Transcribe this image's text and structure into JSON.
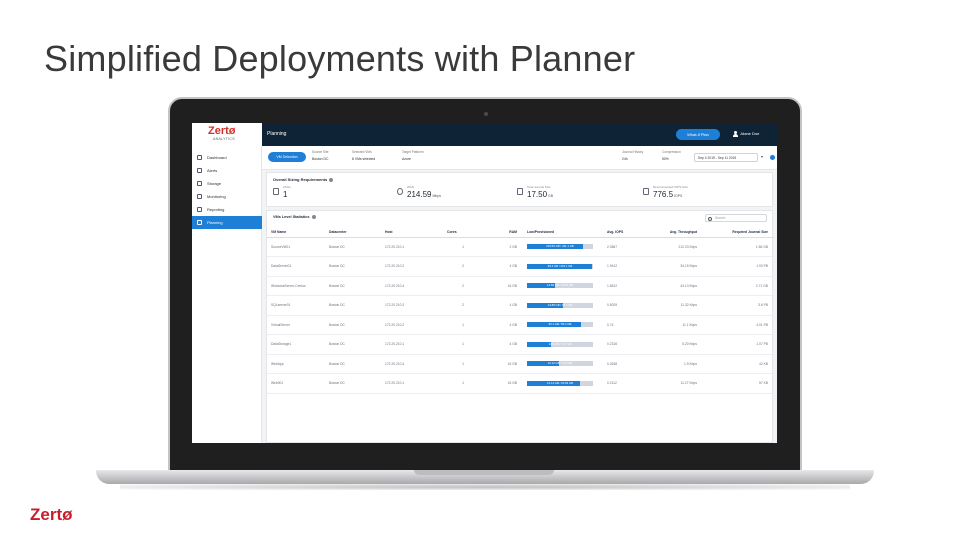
{
  "slide": {
    "title": "Simplified Deployments with Planner",
    "footer_logo": "Zertø"
  },
  "app": {
    "logo": "Zertø",
    "logo_sub": "ANALYTICS",
    "page_label": "Planning",
    "header_button": "What-if Plan",
    "user": "Jdane Doe"
  },
  "sidebar": {
    "items": [
      {
        "label": "Dashboard",
        "icon": "dashboard-icon"
      },
      {
        "label": "Alerts",
        "icon": "alerts-icon"
      },
      {
        "label": "Storage",
        "icon": "storage-icon"
      },
      {
        "label": "Monitoring",
        "icon": "monitoring-icon"
      },
      {
        "label": "Reporting",
        "icon": "reporting-icon"
      },
      {
        "label": "Planning",
        "icon": "planning-icon"
      }
    ],
    "active_index": 5
  },
  "infobar": {
    "vm_button": "VM Selection",
    "cells": [
      {
        "label": "Source Site",
        "value": "Boston DC"
      },
      {
        "label": "Selected VMs",
        "value": "8 VMs selected"
      },
      {
        "label": "Target Platform",
        "value": "Azure"
      },
      {
        "label": "Journal History",
        "value": "24h"
      },
      {
        "label": "Compression",
        "value": "50%"
      }
    ],
    "date_range": "Sep 4 2019 - Sep 11 2019"
  },
  "sizing": {
    "title": "Overall Sizing Requirements",
    "metrics": [
      {
        "label": "ZCAs",
        "value": "1",
        "unit": ""
      },
      {
        "label": "WAN",
        "value": "214.59",
        "unit": "Mbps"
      },
      {
        "label": "Total Journal Size",
        "value": "17.50",
        "unit": "GB"
      },
      {
        "label": "Recommended IOPS Size",
        "value": "776.5",
        "unit": "IOPS"
      }
    ]
  },
  "table": {
    "title": "VMs Level Statistics",
    "search_placeholder": "Search",
    "columns": [
      "VM Name",
      "Datacenter",
      "Host",
      "Cores",
      "RAM",
      "Low/Provisioned",
      "Avg. IOPS",
      "Avg. Throughput",
      "Required Journal Size"
    ],
    "rows": [
      {
        "cells": [
          "SourceVM01",
          "Boston DC",
          "172.20.210.1",
          "1",
          "2 GB",
          "",
          "2.3567",
          "212.23 Kbps",
          "1.56 GB"
        ],
        "bar_text": "218.56 GB / 431.1 GB",
        "bar_fraction": 0.85
      },
      {
        "cells": [
          "DataServer01",
          "Boston DC",
          "172.20.210.2",
          "2",
          "4 GB",
          "",
          "1.9412",
          "34.15 Kbps",
          "1.93 PB"
        ],
        "bar_text": "89.3 GB / 203.1 GB",
        "bar_fraction": 0.98
      },
      {
        "cells": [
          "WindowsServer-Centos",
          "Boston DC",
          "172.20.210.4",
          "2",
          "16 GB",
          "",
          "1.8512",
          "44.13 Kbps",
          "2.71 GB"
        ],
        "bar_text": "12.89 GB / 149.5 GB",
        "bar_fraction": 0.42
      },
      {
        "cells": [
          "SQLserver01",
          "Boston DC",
          "172.20.210.2",
          "2",
          "4 GB",
          "",
          "0.5029",
          "11.32 Kbps",
          "3.6 PB"
        ],
        "bar_text": "13.88 GB / 43.1 GB",
        "bar_fraction": 0.55
      },
      {
        "cells": [
          "VirtualServer",
          "Boston DC",
          "172.20.210.2",
          "1",
          "4 GB",
          "",
          "0.74",
          "11.1 Kbps",
          "4.01 PB"
        ],
        "bar_text": "83.1 GB / 89.4 GB",
        "bar_fraction": 0.82
      },
      {
        "cells": [
          "DataStorage1",
          "Boston DC",
          "172.20.210.1",
          "1",
          "4 GB",
          "",
          "0.2316",
          "5.20 Kbps",
          "1.07 PB"
        ],
        "bar_text": "14.9 GB / 70.1 GB",
        "bar_fraction": 0.36
      },
      {
        "cells": [
          "WebApp",
          "Boston DC",
          "172.20.210.4",
          "1",
          "16 GB",
          "",
          "0.2638",
          "1.9 Kbps",
          "42 KB"
        ],
        "bar_text": "10.12 GB / 19.9 GB",
        "bar_fraction": 0.48
      },
      {
        "cells": [
          "Web001",
          "Boston DC",
          "172.20.210.1",
          "1",
          "16 GB",
          "",
          "0.2112",
          "11.27 Kbps",
          "57 KB"
        ],
        "bar_text": "16.14 GB / 20.56 GB",
        "bar_fraction": 0.8
      }
    ]
  },
  "colors": {
    "header_bg": "#0e2335",
    "accent": "#1e7fd6",
    "brand_red": "#c81e2a"
  }
}
